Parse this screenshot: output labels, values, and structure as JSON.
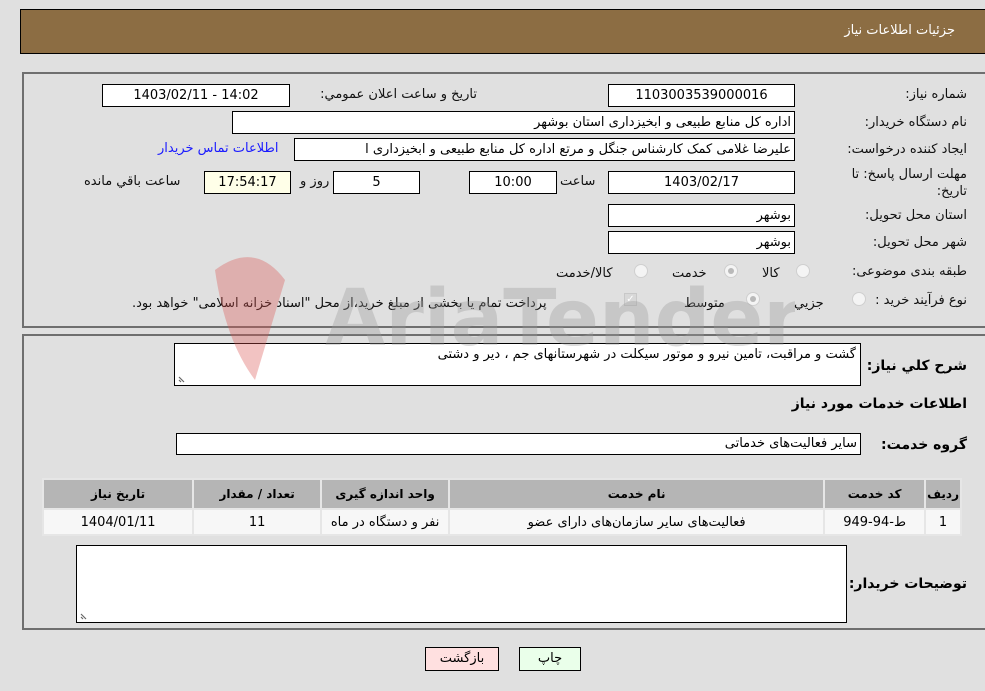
{
  "header": {
    "title": "جزئیات اطلاعات نیاز"
  },
  "form": {
    "need_number": {
      "label": "شماره نیاز:",
      "value": "1103003539000016"
    },
    "announce_datetime": {
      "label": "تاریخ و ساعت اعلان عمومي:",
      "value": "1403/02/11 - 14:02"
    },
    "buyer_org": {
      "label": "نام دستگاه خریدار:",
      "value": "اداره کل منابع طبیعی و ابخیزداری استان بوشهر"
    },
    "requester": {
      "label": "ایجاد کننده درخواست:",
      "value": "علیرضا غلامی کمک کارشناس جنگل و مرتع اداره کل منابع طبیعی و ابخیزداری ا",
      "contact_link": "اطلاعات تماس خریدار"
    },
    "deadline": {
      "label": "مهلت ارسال پاسخ: تا تاریخ:",
      "date": "1403/02/17",
      "time_label": "ساعت",
      "time": "10:00",
      "days": "5",
      "days_label": "روز و",
      "remaining": "17:54:17",
      "remaining_label": "ساعت باقي مانده"
    },
    "delivery_province": {
      "label": "استان محل تحویل:",
      "value": "بوشهر"
    },
    "delivery_city": {
      "label": "شهر محل تحویل:",
      "value": "بوشهر"
    },
    "category": {
      "label": "طبقه بندی موضوعی:",
      "options": [
        "کالا",
        "خدمت",
        "کالا/خدمت"
      ],
      "selected": "خدمت"
    },
    "purchase_type": {
      "label": "نوع فرآیند خرید :",
      "options": [
        "جزيي",
        "متوسط"
      ],
      "selected": "متوسط",
      "treasury_note": "پرداخت تمام یا بخشی از مبلغ خرید،از محل \"اسناد خزانه اسلامی\" خواهد بود.",
      "treasury_checked": true
    }
  },
  "details": {
    "description_label": "شرح کلي نياز:",
    "description": "گشت و مراقبت، تامین نیرو و موتور سیکلت در شهرستانهای جم ، دیر و دشتی",
    "services_heading": "اطلاعات خدمات مورد نیاز",
    "service_group_label": "گروه خدمت:",
    "service_group": "سایر فعالیت‌های خدماتی",
    "table": {
      "headers": [
        "ردیف",
        "کد خدمت",
        "نام خدمت",
        "واحد اندازه گیری",
        "تعداد / مقدار",
        "تاریخ نیاز"
      ],
      "rows": [
        [
          "1",
          "ط-94-949",
          "فعالیت‌های سایر سازمان‌های دارای عضو",
          "نفر و دستگاه در ماه",
          "11",
          "1404/01/11"
        ]
      ]
    },
    "buyer_notes_label": "توضیحات خریدار:",
    "buyer_notes": ""
  },
  "buttons": {
    "print": "چاپ",
    "back": "بازگشت"
  },
  "watermark": {
    "text": "AriaTender.neT"
  },
  "colors": {
    "header_bg": "#8c6d43",
    "link": "#1a1aff",
    "print_bg": "#eaffea",
    "back_bg": "#ffe0e0",
    "remaining_bg": "#ffffe8"
  }
}
